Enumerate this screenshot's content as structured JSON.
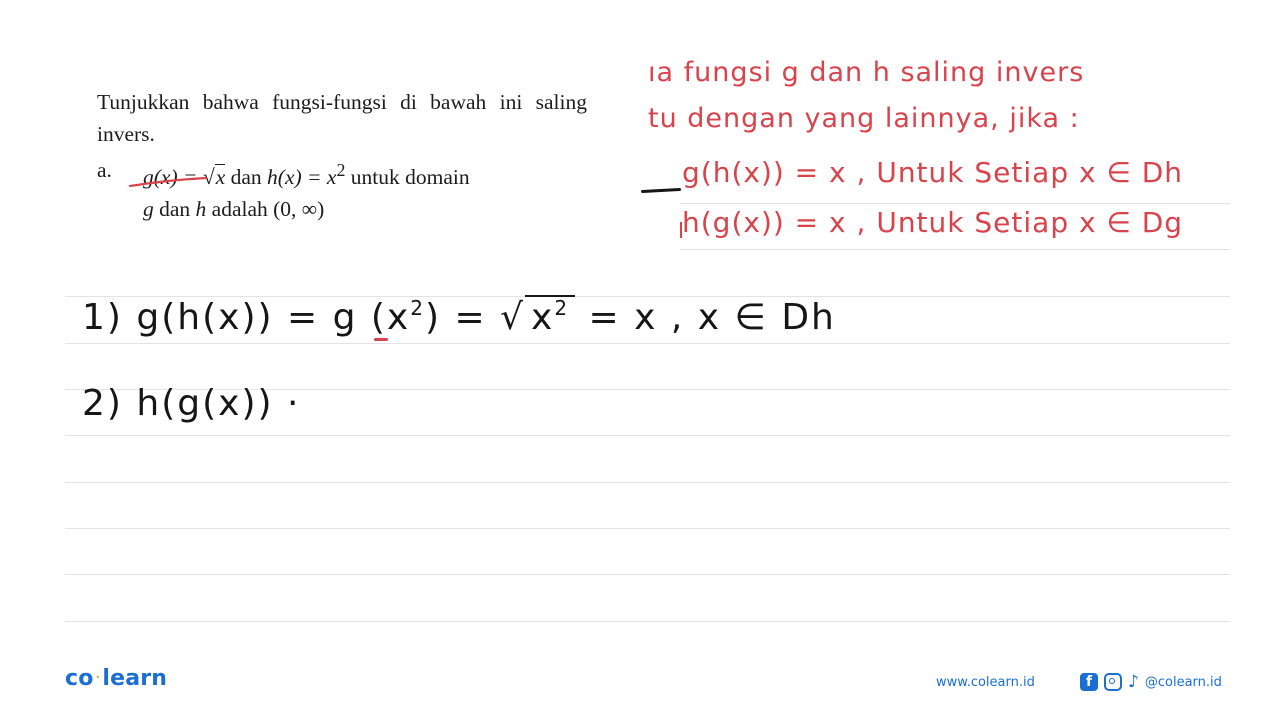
{
  "problem": {
    "intro": "Tunjukkan bahwa fungsi-fungsi di bawah ini saling invers.",
    "item_letter": "a.",
    "item": {
      "g_def": "g(x) = ",
      "g_sqrt_arg": "x",
      "conj": " dan ",
      "h_def": "h(x) = x",
      "h_exp": "2",
      "tail": " untuk domain",
      "line2_g": "g",
      "line2_mid": " dan ",
      "line2_h": "h",
      "line2_tail": " adalah (0, ∞)"
    }
  },
  "annotations": {
    "red_line1": "ıa fungsi  g  dan  h   saling  invers",
    "red_line2": "tu dengan yang  lainnya,  jika :",
    "red_line3": "g(h(x))   = x ,  Untuk Setiap  x ∈ Dh",
    "red_line4": "h(g(x)) = x ,  Untuk  Setiap  x ∈ Dg"
  },
  "work": {
    "step1_prefix": "1)  g(h(x)) = g (x",
    "step1_exp": "2",
    "step1_mid": ") = √",
    "step1_sqrt_arg": "x",
    "step1_sqrt_exp": "2",
    "step1_tail": "  =  x ,  x ∈ Dh",
    "step2": "2)  h(g(x)) ·"
  },
  "footer": {
    "logo_left": "co",
    "logo_dot": "·",
    "logo_right": "learn",
    "website": "www.colearn.id",
    "fb_glyph": "f",
    "tiktok_glyph": "♪",
    "handle": "@colearn.id"
  },
  "colors": {
    "ink_red": "#d9434b",
    "ink_black": "#161616",
    "brand_blue": "#1b6fd1",
    "brand_yellow": "#f5b82e",
    "rule": "#e3e3e3"
  }
}
